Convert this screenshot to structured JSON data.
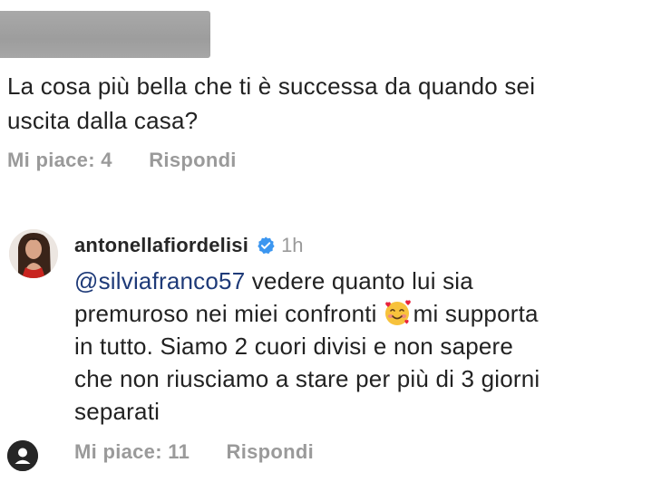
{
  "comment": {
    "text_line1": "La cosa più bella che ti è successa da quando sei",
    "text_line2": "uscita dalla casa?",
    "like_label": "Mi piace: 4",
    "reply_label": "Rispondi"
  },
  "reply": {
    "username": "antonellafiordelisi",
    "time": "1h",
    "mention": "@silviafranco57",
    "text_part1": " vedere quanto lui sia",
    "text_part2": "premuroso nei miei confronti",
    "text_part3": "mi supporta",
    "text_part4": "in tutto. Siamo 2 cuori divisi e non sapere",
    "text_part5": "che non riusciamo a stare per più di 3 giorni",
    "text_part6": "separati",
    "like_label": "Mi piace: 11",
    "reply_label": "Rispondi"
  },
  "icons": {
    "verified": "verified-badge-icon",
    "emoji": "smiling-face-with-hearts-emoji",
    "profile": "profile-icon"
  },
  "colors": {
    "mention": "#1e3a78",
    "verified": "#3b96f0",
    "meta_text": "#9a9a9a",
    "redaction": "#a3a3a3"
  }
}
